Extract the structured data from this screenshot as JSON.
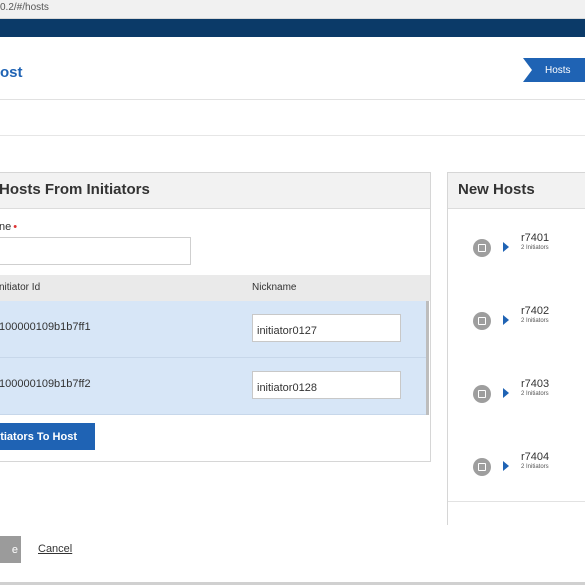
{
  "browser": {
    "address": "0.2/#/hosts"
  },
  "header": {
    "title": "ost",
    "breadcrumb": "Hosts"
  },
  "left_panel": {
    "title": "Hosts From Initiators",
    "name_label": "ne",
    "columns": [
      "nitiator Id",
      "Nickname"
    ],
    "rows": [
      {
        "initiator_id": "100000109b1b7ff1",
        "nickname": "initiator0127"
      },
      {
        "initiator_id": "100000109b1b7ff2",
        "nickname": "initiator0128"
      }
    ],
    "add_button": "itiators To Host"
  },
  "right_panel": {
    "title": "New Hosts",
    "hosts": [
      {
        "name": "r7401",
        "sub": "2 Initiators"
      },
      {
        "name": "r7402",
        "sub": "2 Initiators"
      },
      {
        "name": "r7403",
        "sub": "2 Initiators"
      },
      {
        "name": "r7404",
        "sub": "2 Initiators"
      }
    ]
  },
  "footer": {
    "save": "e",
    "cancel": "Cancel"
  },
  "colors": {
    "brand": "#0b3a68",
    "accent": "#1f63b4",
    "selected_row": "#d7e6f7"
  }
}
